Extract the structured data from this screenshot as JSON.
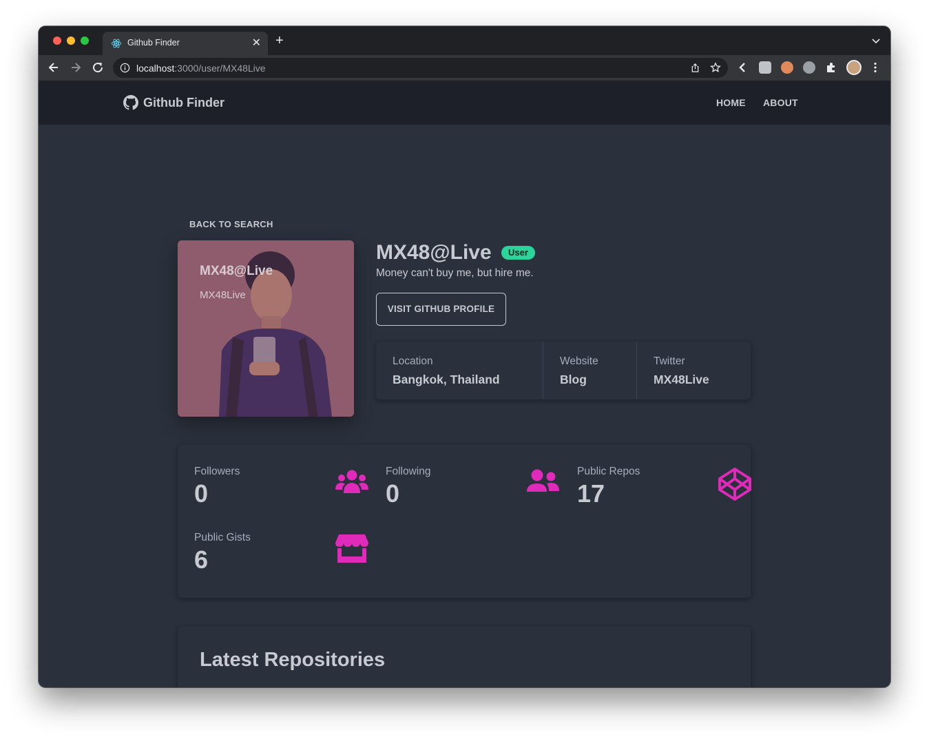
{
  "browser": {
    "tab_title": "Github Finder",
    "new_tab_label": "+",
    "close_label": "✕",
    "url_host": "localhost",
    "url_path": ":3000/user/MX48Live"
  },
  "header": {
    "brand": "Github Finder",
    "nav": [
      "HOME",
      "ABOUT"
    ]
  },
  "profile": {
    "back_link": "BACK TO SEARCH",
    "avatar_name": "MX48@Live",
    "avatar_login": "MX48Live",
    "name": "MX48@Live",
    "badge": "User",
    "bio": "Money can't buy me, but hire me.",
    "visit_button": "VISIT GITHUB PROFILE",
    "info": [
      {
        "label": "Location",
        "value": "Bangkok, Thailand"
      },
      {
        "label": "Website",
        "value": "Blog"
      },
      {
        "label": "Twitter",
        "value": "MX48Live"
      }
    ]
  },
  "stats": [
    {
      "label": "Followers",
      "value": "0",
      "icon": "users-icon"
    },
    {
      "label": "Following",
      "value": "0",
      "icon": "user-friends-icon"
    },
    {
      "label": "Public Repos",
      "value": "17",
      "icon": "codepen-icon"
    },
    {
      "label": "Public Gists",
      "value": "6",
      "icon": "store-icon"
    }
  ],
  "repos": {
    "title": "Latest Repositories"
  },
  "colors": {
    "accent": "#e02ab9",
    "badge": "#2bd49b",
    "background": "#2a303c",
    "header": "#1d2028"
  }
}
